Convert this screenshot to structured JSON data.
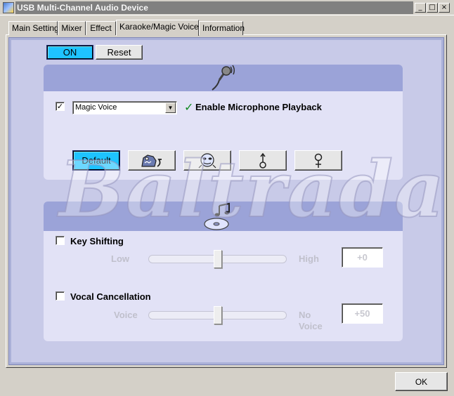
{
  "window": {
    "title": "USB Multi-Channel Audio Device",
    "minimize": "_",
    "maximize": "□",
    "close": "×"
  },
  "tabs": [
    {
      "label": "Main Setting"
    },
    {
      "label": "Mixer"
    },
    {
      "label": "Effect"
    },
    {
      "label": "Karaoke/Magic Voice"
    },
    {
      "label": "Information"
    }
  ],
  "toolbar": {
    "on_label": "ON",
    "reset_label": "Reset"
  },
  "magic_voice": {
    "checked": "✓",
    "selected_option": "Magic Voice",
    "enable_playback_label": "Enable Microphone Playback",
    "check_mark": "✓",
    "presets": {
      "default_label": "Default"
    }
  },
  "key_shifting": {
    "label": "Key Shifting",
    "low_label": "Low",
    "high_label": "High",
    "value": "+0",
    "slider_fraction": 0.5
  },
  "vocal_cancellation": {
    "label": "Vocal Cancellation",
    "voice_label": "Voice",
    "no_voice_label_1": "No",
    "no_voice_label_2": "Voice",
    "value": "+50",
    "slider_fraction": 0.5
  },
  "watermark": "Baltrada",
  "footer": {
    "ok_label": "OK"
  },
  "colors": {
    "accent_blue": "#1ec3ff",
    "panel_lavender": "#c8cae8",
    "section_header": "#9ba3d8"
  }
}
